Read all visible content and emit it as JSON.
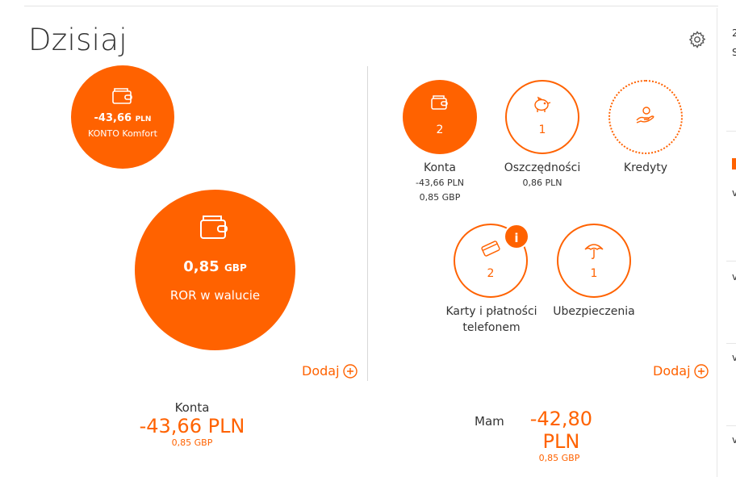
{
  "page": {
    "title": "Dzisiaj"
  },
  "colors": {
    "accent": "#ff6200",
    "text": "#333333"
  },
  "icons": {
    "settings": "gear-icon",
    "wallet": "wallet-icon",
    "piggy": "piggy-bank-icon",
    "loan": "hand-coin-icon",
    "card": "card-icon",
    "umbrella": "umbrella-icon",
    "add": "plus-circle-icon"
  },
  "left": {
    "small_account": {
      "amount": "-43,66",
      "currency": "PLN",
      "name": "KONTO Komfort"
    },
    "big_account": {
      "amount": "0,85",
      "currency": "GBP",
      "name": "ROR w walucie"
    },
    "add_label": "Dodaj",
    "summary": {
      "label": "Konta",
      "amount": "-43,66 PLN",
      "sub": "0,85 GBP"
    }
  },
  "right": {
    "categories": [
      {
        "count": "2",
        "name": "Konta",
        "line1": "-43,66 PLN",
        "line2": "0,85 GBP"
      },
      {
        "count": "1",
        "name": "Oszczędności",
        "line1": "0,86 PLN"
      },
      {
        "name": "Kredyty"
      },
      {
        "count": "2",
        "name": "Karty i płatności telefonem",
        "badge": "i"
      },
      {
        "count": "1",
        "name": "Ubezpieczenia"
      }
    ],
    "add_label": "Dodaj",
    "summary": {
      "label": "Mam",
      "amount": "-42,80 PLN",
      "sub": "0,85 GBP"
    }
  }
}
